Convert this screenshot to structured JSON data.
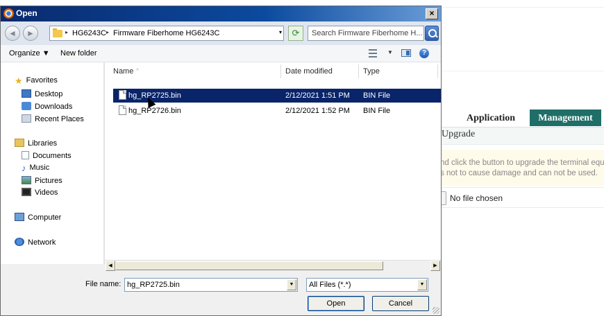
{
  "dialog": {
    "title": "Open",
    "close_label": "×",
    "address": {
      "segments": [
        "HG6243C",
        "Firmware Fiberhome HG6243C"
      ],
      "chevron": "▸",
      "dropdown": "▾"
    },
    "search_placeholder": "Search Firmware Fiberhome H...",
    "toolbar": {
      "organize_label": "Organize ▼",
      "new_folder_label": "New folder",
      "views_chevron": "▼",
      "help_label": "?"
    },
    "sidebar": {
      "favorites": "Favorites",
      "desktop": "Desktop",
      "downloads": "Downloads",
      "recent_places": "Recent Places",
      "libraries": "Libraries",
      "documents": "Documents",
      "music": "Music",
      "pictures": "Pictures",
      "videos": "Videos",
      "computer": "Computer",
      "network": "Network"
    },
    "columns": {
      "name": "Name",
      "date_modified": "Date modified",
      "type": "Type",
      "sort_indicator": "^"
    },
    "files": [
      {
        "name": "hg_RP2725.bin",
        "date": "2/12/2021 1:51 PM",
        "type": "BIN File",
        "selected": true
      },
      {
        "name": "hg_RP2726.bin",
        "date": "2/12/2021 1:52 PM",
        "type": "BIN File",
        "selected": false
      }
    ],
    "scroll": {
      "left": "◀",
      "right": "▶"
    },
    "file_name_label": "File name:",
    "file_name_value": "hg_RP2725.bin",
    "filter_value": "All Files (*.*)",
    "dropdown_arrow": "▼",
    "open_button": "Open",
    "cancel_button": "Cancel"
  },
  "background_page": {
    "tab_application": "Application",
    "tab_management": "Management",
    "management_color": "#1f6e68",
    "section_title": "Upgrade",
    "note_line_1": "nd click the button to upgrade the terminal equ",
    "note_line_2": "s not to cause damage and can not be used.",
    "no_file_chosen": "No file chosen"
  },
  "colors": {
    "selection": "#0a246a",
    "titlebar_start": "#0a2a6e"
  }
}
